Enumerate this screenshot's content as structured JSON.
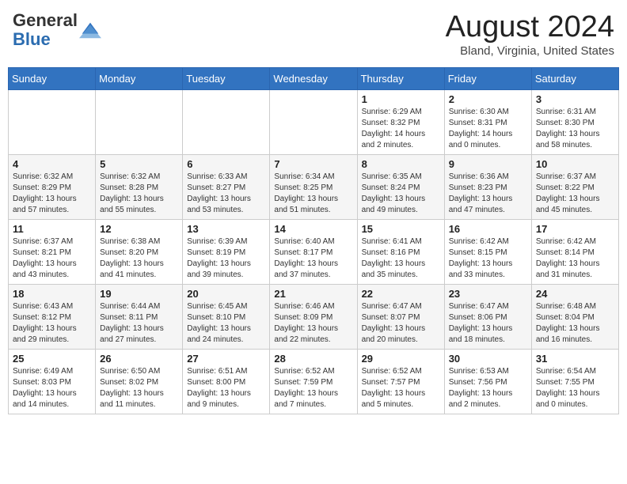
{
  "logo": {
    "general": "General",
    "blue": "Blue"
  },
  "title": "August 2024",
  "location": "Bland, Virginia, United States",
  "days_of_week": [
    "Sunday",
    "Monday",
    "Tuesday",
    "Wednesday",
    "Thursday",
    "Friday",
    "Saturday"
  ],
  "weeks": [
    [
      {
        "day": "",
        "info": ""
      },
      {
        "day": "",
        "info": ""
      },
      {
        "day": "",
        "info": ""
      },
      {
        "day": "",
        "info": ""
      },
      {
        "day": "1",
        "info": "Sunrise: 6:29 AM\nSunset: 8:32 PM\nDaylight: 14 hours\nand 2 minutes."
      },
      {
        "day": "2",
        "info": "Sunrise: 6:30 AM\nSunset: 8:31 PM\nDaylight: 14 hours\nand 0 minutes."
      },
      {
        "day": "3",
        "info": "Sunrise: 6:31 AM\nSunset: 8:30 PM\nDaylight: 13 hours\nand 58 minutes."
      }
    ],
    [
      {
        "day": "4",
        "info": "Sunrise: 6:32 AM\nSunset: 8:29 PM\nDaylight: 13 hours\nand 57 minutes."
      },
      {
        "day": "5",
        "info": "Sunrise: 6:32 AM\nSunset: 8:28 PM\nDaylight: 13 hours\nand 55 minutes."
      },
      {
        "day": "6",
        "info": "Sunrise: 6:33 AM\nSunset: 8:27 PM\nDaylight: 13 hours\nand 53 minutes."
      },
      {
        "day": "7",
        "info": "Sunrise: 6:34 AM\nSunset: 8:25 PM\nDaylight: 13 hours\nand 51 minutes."
      },
      {
        "day": "8",
        "info": "Sunrise: 6:35 AM\nSunset: 8:24 PM\nDaylight: 13 hours\nand 49 minutes."
      },
      {
        "day": "9",
        "info": "Sunrise: 6:36 AM\nSunset: 8:23 PM\nDaylight: 13 hours\nand 47 minutes."
      },
      {
        "day": "10",
        "info": "Sunrise: 6:37 AM\nSunset: 8:22 PM\nDaylight: 13 hours\nand 45 minutes."
      }
    ],
    [
      {
        "day": "11",
        "info": "Sunrise: 6:37 AM\nSunset: 8:21 PM\nDaylight: 13 hours\nand 43 minutes."
      },
      {
        "day": "12",
        "info": "Sunrise: 6:38 AM\nSunset: 8:20 PM\nDaylight: 13 hours\nand 41 minutes."
      },
      {
        "day": "13",
        "info": "Sunrise: 6:39 AM\nSunset: 8:19 PM\nDaylight: 13 hours\nand 39 minutes."
      },
      {
        "day": "14",
        "info": "Sunrise: 6:40 AM\nSunset: 8:17 PM\nDaylight: 13 hours\nand 37 minutes."
      },
      {
        "day": "15",
        "info": "Sunrise: 6:41 AM\nSunset: 8:16 PM\nDaylight: 13 hours\nand 35 minutes."
      },
      {
        "day": "16",
        "info": "Sunrise: 6:42 AM\nSunset: 8:15 PM\nDaylight: 13 hours\nand 33 minutes."
      },
      {
        "day": "17",
        "info": "Sunrise: 6:42 AM\nSunset: 8:14 PM\nDaylight: 13 hours\nand 31 minutes."
      }
    ],
    [
      {
        "day": "18",
        "info": "Sunrise: 6:43 AM\nSunset: 8:12 PM\nDaylight: 13 hours\nand 29 minutes."
      },
      {
        "day": "19",
        "info": "Sunrise: 6:44 AM\nSunset: 8:11 PM\nDaylight: 13 hours\nand 27 minutes."
      },
      {
        "day": "20",
        "info": "Sunrise: 6:45 AM\nSunset: 8:10 PM\nDaylight: 13 hours\nand 24 minutes."
      },
      {
        "day": "21",
        "info": "Sunrise: 6:46 AM\nSunset: 8:09 PM\nDaylight: 13 hours\nand 22 minutes."
      },
      {
        "day": "22",
        "info": "Sunrise: 6:47 AM\nSunset: 8:07 PM\nDaylight: 13 hours\nand 20 minutes."
      },
      {
        "day": "23",
        "info": "Sunrise: 6:47 AM\nSunset: 8:06 PM\nDaylight: 13 hours\nand 18 minutes."
      },
      {
        "day": "24",
        "info": "Sunrise: 6:48 AM\nSunset: 8:04 PM\nDaylight: 13 hours\nand 16 minutes."
      }
    ],
    [
      {
        "day": "25",
        "info": "Sunrise: 6:49 AM\nSunset: 8:03 PM\nDaylight: 13 hours\nand 14 minutes."
      },
      {
        "day": "26",
        "info": "Sunrise: 6:50 AM\nSunset: 8:02 PM\nDaylight: 13 hours\nand 11 minutes."
      },
      {
        "day": "27",
        "info": "Sunrise: 6:51 AM\nSunset: 8:00 PM\nDaylight: 13 hours\nand 9 minutes."
      },
      {
        "day": "28",
        "info": "Sunrise: 6:52 AM\nSunset: 7:59 PM\nDaylight: 13 hours\nand 7 minutes."
      },
      {
        "day": "29",
        "info": "Sunrise: 6:52 AM\nSunset: 7:57 PM\nDaylight: 13 hours\nand 5 minutes."
      },
      {
        "day": "30",
        "info": "Sunrise: 6:53 AM\nSunset: 7:56 PM\nDaylight: 13 hours\nand 2 minutes."
      },
      {
        "day": "31",
        "info": "Sunrise: 6:54 AM\nSunset: 7:55 PM\nDaylight: 13 hours\nand 0 minutes."
      }
    ]
  ]
}
